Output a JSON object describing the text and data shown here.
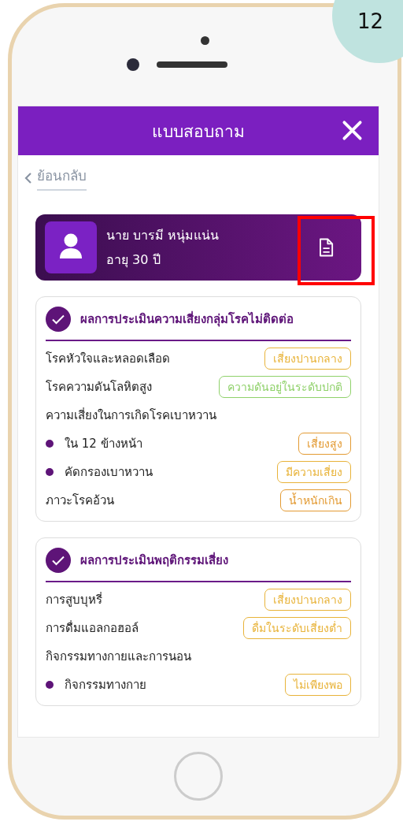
{
  "page_badge": "12",
  "header": {
    "title": "แบบสอบถาม"
  },
  "back_link": "ย้อนกลับ",
  "profile": {
    "name": "นาย บารมี หนุ่มแน่น",
    "age": "อายุ 30 ปี"
  },
  "sections": [
    {
      "title": "ผลการประเมินความเสี่ยงกลุ่มโรคไม่ติดต่อ",
      "rows": [
        {
          "kind": "item",
          "label": "โรคหัวใจและหลอดเลือด",
          "badge": "เสี่ยงปานกลาง",
          "color": "#e8b339"
        },
        {
          "kind": "item",
          "label": "โรคความดันโลหิตสูง",
          "badge": "ความดันอยู่ในระดับปกติ",
          "color": "#8fd16a"
        },
        {
          "kind": "heading",
          "label": "ความเสี่ยงในการเกิดโรคเบาหวาน"
        },
        {
          "kind": "bullet",
          "label": "ใน 12 ข้างหน้า",
          "badge": "เสี่ยงสูง",
          "color": "#e39a32"
        },
        {
          "kind": "bullet",
          "label": "คัดกรองเบาหวาน",
          "badge": "มีความเสี่ยง",
          "color": "#e8b339"
        },
        {
          "kind": "item",
          "label": "ภาวะโรคอ้วน",
          "badge": "น้ำหนักเกิน",
          "color": "#e39a32"
        }
      ]
    },
    {
      "title": "ผลการประเมินพฤติกรรมเสี่ยง",
      "rows": [
        {
          "kind": "item",
          "label": "การสูบบุหรี่",
          "badge": "เสี่ยงปานกลาง",
          "color": "#e8b339"
        },
        {
          "kind": "item",
          "label": "การดื่มแอลกอฮอล์",
          "badge": "ดื่มในระดับเสี่ยงต่ำ",
          "color": "#e8b339"
        },
        {
          "kind": "heading",
          "label": "กิจกรรมทางกายและการนอน"
        },
        {
          "kind": "bullet",
          "label": "กิจกรรมทางกาย",
          "badge": "ไม่เพียงพอ",
          "color": "#e8b339"
        }
      ]
    }
  ]
}
